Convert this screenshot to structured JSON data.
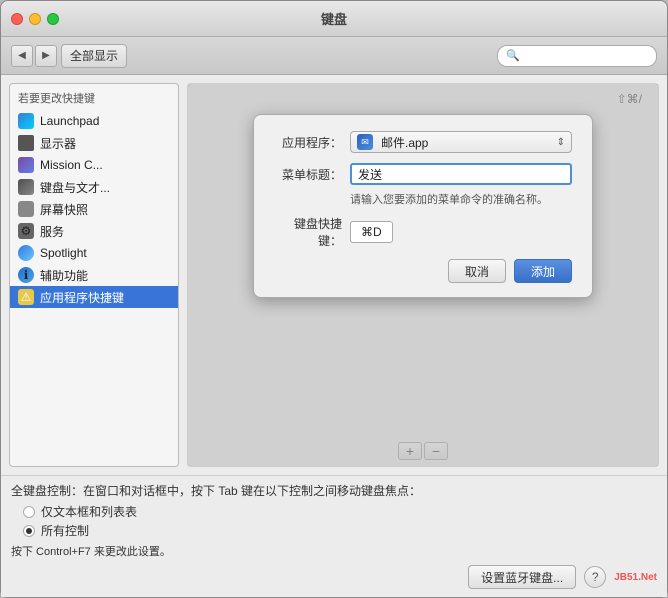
{
  "window": {
    "title": "键盘"
  },
  "toolbar": {
    "back_label": "◀",
    "forward_label": "▶",
    "show_all_label": "全部显示",
    "search_placeholder": ""
  },
  "left_panel": {
    "header": "若要更改快捷键",
    "items": [
      {
        "id": "launchpad",
        "label": "Launchpad",
        "icon_type": "launchpad"
      },
      {
        "id": "display",
        "label": "显示器",
        "icon_type": "display"
      },
      {
        "id": "mission",
        "label": "Mission C...",
        "icon_type": "mission"
      },
      {
        "id": "keyboard",
        "label": "键盘与文才...",
        "icon_type": "keyboard"
      },
      {
        "id": "screenshot",
        "label": "屏幕快照",
        "icon_type": "screen"
      },
      {
        "id": "services",
        "label": "服务",
        "icon_type": "service"
      },
      {
        "id": "spotlight",
        "label": "Spotlight",
        "icon_type": "spotlight"
      },
      {
        "id": "accessibility",
        "label": "辅助功能",
        "icon_type": "access"
      },
      {
        "id": "appshortcuts",
        "label": "应用程序快捷键",
        "icon_type": "appshortcut"
      }
    ]
  },
  "dialog": {
    "app_label": "应用程序：",
    "app_value": "邮件.app",
    "menu_label": "菜单标题：",
    "menu_value": "发送",
    "hint": "请输入您要添加的菜单命令的准确名称。",
    "shortcut_label": "键盘快捷键：",
    "shortcut_value": "⌘D",
    "cancel_label": "取消",
    "add_label": "添加"
  },
  "right_shortcut": "⇧⌘/",
  "bottom": {
    "add_symbol": "+",
    "remove_symbol": "−"
  },
  "footer": {
    "main_text": "全键盘控制：在窗口和对话框中，按下 Tab 键在以下控制之间移动键盘焦点：",
    "radio1_label": "仅文本框和列表表",
    "radio2_label": "所有控制",
    "radio1_checked": false,
    "radio2_checked": true,
    "note": "按下 Control+F7 来更改此设置。",
    "bluetooth_label": "设置蓝牙键盘...",
    "help_label": "?"
  },
  "watermark": "JB51.Net"
}
